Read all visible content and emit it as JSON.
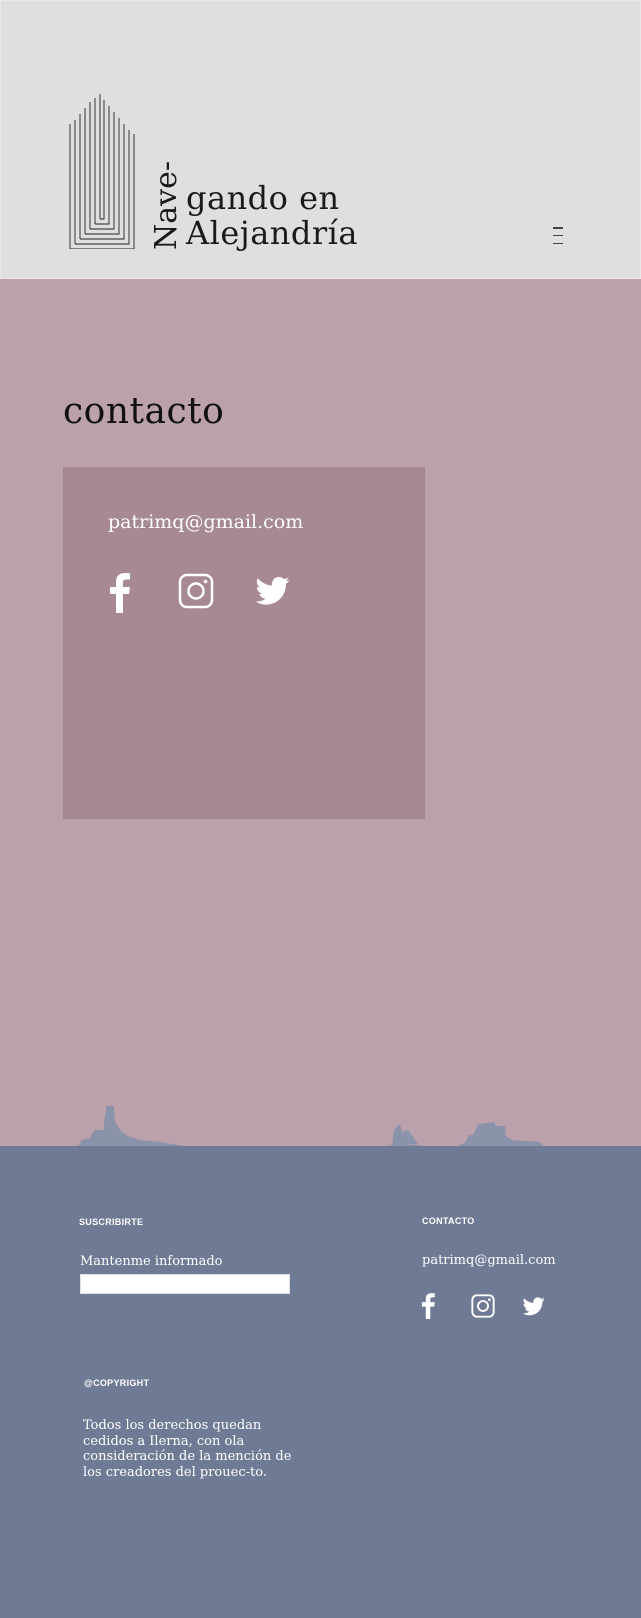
{
  "header": {
    "logo_vertical": "Nave-",
    "logo_line1": "gando en",
    "logo_line2": "Alejandría",
    "menu_icon": "hamburger-menu-icon"
  },
  "main": {
    "title": "contacto",
    "card": {
      "email": "patrimq@gmail.com",
      "social_icons": [
        "facebook-icon",
        "instagram-icon",
        "twitter-icon"
      ]
    }
  },
  "footer": {
    "subscribe_title": "SUSCRIBIRTE",
    "subscribe_label": "Mantenme informado",
    "subscribe_input_value": "",
    "contact_title": "CONTACTO",
    "contact_email": "patrimq@gmail.com",
    "social_icons": [
      "facebook-icon",
      "instagram-icon",
      "twitter-icon"
    ],
    "copyright_title": "@COPYRIGHT",
    "legal_text": "Todos los derechos quedan cedidos a Ilerna, con ola consideración de la mención de los creadores del prouec-to."
  },
  "colors": {
    "header_bg": "#dfdfdf",
    "main_bg": "#bba1ab",
    "card_bg": "#a78994",
    "footer_bg": "#6f7a94",
    "silhouette": "#8b93ab"
  }
}
